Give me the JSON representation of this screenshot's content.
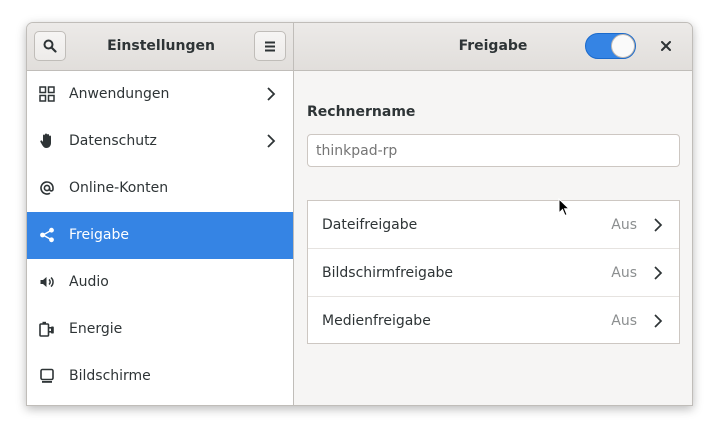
{
  "header": {
    "left_title": "Einstellungen",
    "right_title": "Freigabe",
    "search_icon": "search-icon",
    "menu_icon": "hamburger-menu-icon",
    "close_icon": "close-icon",
    "switch_on": true
  },
  "sidebar": {
    "items": [
      {
        "label": "Anwendungen",
        "icon": "apps-grid-icon",
        "chevron": true,
        "active": false
      },
      {
        "label": "Datenschutz",
        "icon": "hand-icon",
        "chevron": true,
        "active": false
      },
      {
        "label": "Online-Konten",
        "icon": "at-icon",
        "chevron": false,
        "active": false
      },
      {
        "label": "Freigabe",
        "icon": "share-icon",
        "chevron": false,
        "active": true
      },
      {
        "label": "Audio",
        "icon": "speaker-icon",
        "chevron": false,
        "active": false
      },
      {
        "label": "Energie",
        "icon": "power-plug-icon",
        "chevron": false,
        "active": false
      },
      {
        "label": "Bildschirme",
        "icon": "monitor-icon",
        "chevron": false,
        "active": false
      }
    ]
  },
  "content": {
    "section_title": "Rechnername",
    "computer_name_placeholder": "thinkpad-rp",
    "rows": [
      {
        "label": "Dateifreigabe",
        "status": "Aus"
      },
      {
        "label": "Bildschirmfreigabe",
        "status": "Aus"
      },
      {
        "label": "Medienfreigabe",
        "status": "Aus"
      }
    ]
  },
  "colors": {
    "accent": "#3584e4",
    "window_bg": "#f6f5f4",
    "dim_text": "#8b8e8f"
  }
}
